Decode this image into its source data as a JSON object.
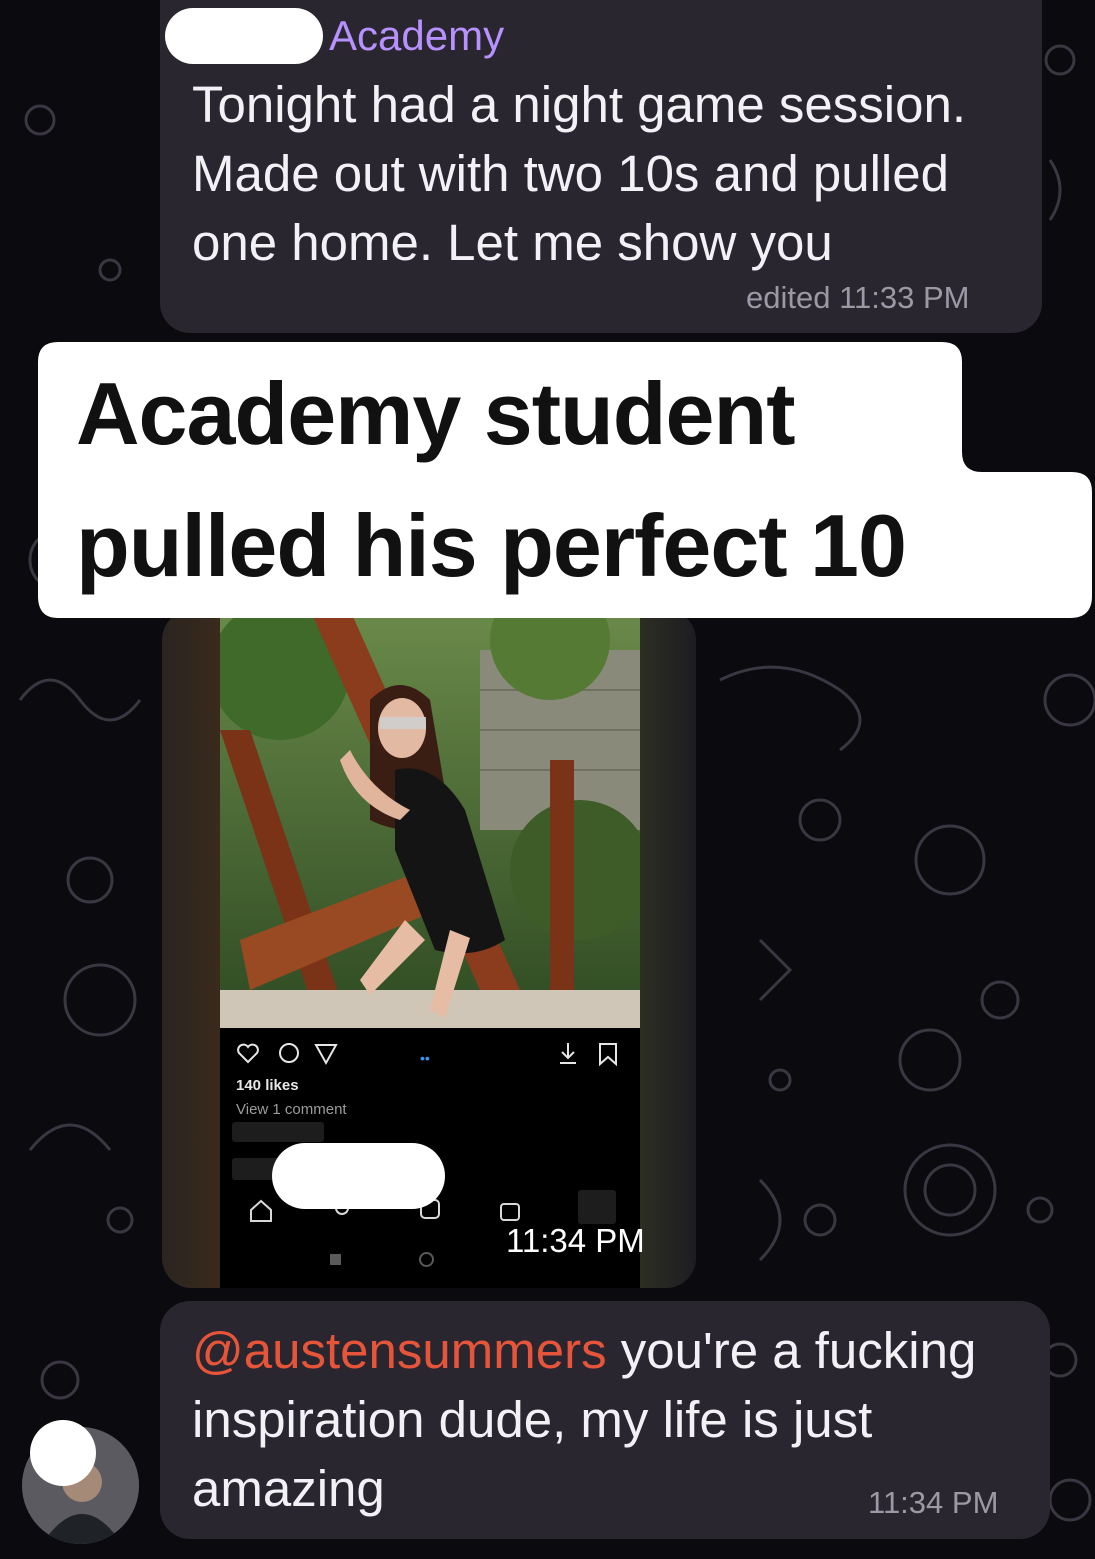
{
  "messages": [
    {
      "sender": "Academy",
      "lines": [
        "Tonight had a night game session.",
        "Made out with two 10s and pulled",
        "one home. Let me show you"
      ],
      "meta": "edited 11:33 PM"
    },
    {
      "media_time": "11:34 PM",
      "embedded_post": {
        "likes": "140 likes",
        "comments": "View 1 comment"
      }
    },
    {
      "mention": "@austensummers",
      "lines": [
        " you're a fucking",
        "inspiration dude, my life is just",
        "amazing"
      ],
      "time": "11:34 PM"
    }
  ],
  "caption": {
    "line1": "Academy student",
    "line2": "pulled his perfect 10"
  },
  "icons": [
    "heart-icon",
    "comment-icon",
    "send-icon",
    "download-icon",
    "bookmark-icon",
    "home-icon",
    "search-icon",
    "reels-icon",
    "shop-icon"
  ]
}
